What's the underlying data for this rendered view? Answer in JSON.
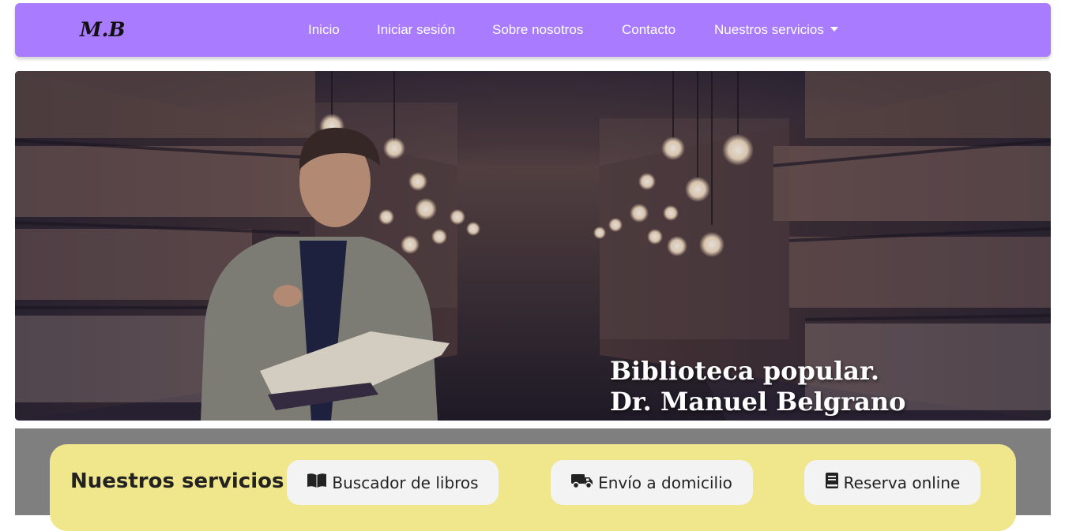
{
  "navbar": {
    "brand": "M.B",
    "links": [
      {
        "label": "Inicio"
      },
      {
        "label": "Iniciar sesión"
      },
      {
        "label": "Sobre nosotros"
      },
      {
        "label": "Contacto"
      },
      {
        "label": "Nuestros servicios",
        "dropdown": true
      }
    ],
    "color": "#a97bff"
  },
  "hero": {
    "title_line1": "Biblioteca popular.",
    "title_line2": "Dr. Manuel Belgrano"
  },
  "services": {
    "title": "Nuestros servicios",
    "buttons": [
      {
        "label": "Buscador de libros",
        "icon": "book-open-icon"
      },
      {
        "label": "Envío a domicilio",
        "icon": "truck-icon"
      },
      {
        "label": "Reserva online",
        "icon": "book-icon"
      }
    ],
    "card_color": "#f0e68c",
    "background_color": "#7f7f7f"
  }
}
